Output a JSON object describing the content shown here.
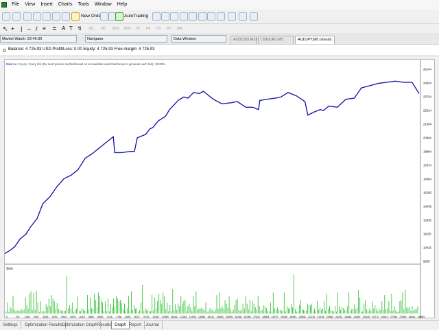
{
  "menu": [
    "File",
    "View",
    "Insert",
    "Charts",
    "Tools",
    "Window",
    "Help"
  ],
  "toolbar": {
    "new_order": "New Order",
    "auto_trading": "AutoTrading",
    "timeframes": [
      "M1",
      "M5",
      "M15",
      "M30",
      "H1",
      "H4",
      "D1",
      "W1",
      "MN"
    ]
  },
  "panels": {
    "market_watch": "Market Watch: 22:40:30",
    "navigator": "Navigator",
    "data_window": "Data Window"
  },
  "chart_tabs": [
    {
      "label": "AUDUSD,M15",
      "active": false
    },
    {
      "label": "USDCAD,M5 (visual)",
      "active": false
    },
    {
      "label": "AUDJPY,M5 (visual)",
      "active": true
    }
  ],
  "balance_line": "Balance: 4 725.93 USD  Profit/Loss: 0.00  Equity: 4 725.93  Free margin: 4 725.93",
  "legend": {
    "balance": "Balance",
    "equity": "Equity",
    "note": "Every tick (the most precise method based on all available least timeframes to generate each tick)",
    "quality": "90.00%"
  },
  "size_label": "Size",
  "colors": {
    "balance": "#1a1aa8",
    "size_bars": "#22bb22"
  },
  "chart_data": {
    "type": "line",
    "y_ticks": [
      "26144",
      "24934",
      "23724",
      "22514",
      "21304",
      "20094",
      "18884",
      "17674",
      "16464",
      "15255",
      "14045",
      "12835",
      "11625",
      "10415",
      "9205"
    ],
    "x_ticks": [
      "0",
      "723",
      "1365",
      "2007",
      "2649",
      "3292",
      "3934",
      "4576",
      "5218",
      "5861",
      "6503",
      "7145",
      "7788",
      "8430",
      "9072",
      "9715",
      "10357",
      "10999",
      "11642",
      "12284",
      "12926",
      "13568",
      "14211",
      "14853",
      "15495",
      "16138",
      "16780",
      "17422",
      "18064",
      "18707",
      "19349",
      "19991",
      "20634",
      "21276",
      "21918",
      "22560",
      "23203",
      "23845",
      "24487",
      "25130",
      "25772",
      "26414",
      "27056",
      "27699",
      "28341",
      "28983"
    ],
    "ylim": [
      9205,
      26144
    ],
    "xlim": [
      0,
      29500
    ],
    "series": [
      {
        "name": "Balance",
        "x": [
          0,
          400,
          700,
          1100,
          1500,
          1800,
          2300,
          2700,
          3200,
          3700,
          4200,
          4700,
          5200,
          5700,
          6200,
          6700,
          7200,
          7700,
          7800,
          8300,
          8900,
          9200,
          9400,
          10000,
          10300,
          10500,
          10900,
          11400,
          11700,
          12300,
          12700,
          13000,
          13400,
          13800,
          14100,
          14800,
          15400,
          16100,
          16500,
          17100,
          17600,
          18000,
          18100,
          18600,
          19200,
          19600,
          20100,
          20700,
          21300,
          21500,
          22000,
          22400,
          22600,
          23000,
          23600,
          24200,
          24800,
          25300,
          25900,
          26500,
          27100,
          27700,
          28300,
          28900,
          29100,
          29400
        ],
        "y": [
          9900,
          10200,
          10500,
          11200,
          11600,
          12200,
          13000,
          14300,
          14900,
          15800,
          16500,
          16800,
          17300,
          18300,
          18700,
          19200,
          19700,
          20200,
          18800,
          18800,
          18900,
          18900,
          20100,
          20400,
          20900,
          21000,
          21600,
          22000,
          22600,
          23400,
          23700,
          23600,
          24100,
          24000,
          24200,
          23500,
          23100,
          23200,
          23300,
          22800,
          22800,
          22600,
          23400,
          23500,
          23600,
          23700,
          24100,
          23800,
          23300,
          22100,
          22400,
          22600,
          22500,
          22900,
          22800,
          23500,
          23600,
          24500,
          24700,
          24900,
          25000,
          25100,
          25000,
          25000,
          24600,
          24000
        ]
      }
    ],
    "size_bars": [
      0.05,
      0.12,
      0.08,
      0.2,
      0.06,
      0.15,
      0.3,
      0.1,
      0.45,
      0.12,
      0.08,
      0.22,
      0.5,
      0.1,
      0.14,
      0.35,
      0.07,
      0.18,
      0.4,
      0.11,
      0.09,
      0.28,
      0.06,
      0.55,
      0.13,
      0.1,
      0.32,
      0.08,
      0.6,
      0.2,
      0.12,
      0.17,
      0.45,
      0.09,
      0.1,
      0.3,
      0.14,
      0.7,
      0.2,
      0.11,
      0.08,
      0.38,
      0.16,
      0.55,
      0.12,
      0.1,
      0.28,
      0.2,
      0.85,
      0.15,
      0.1,
      0.35,
      0.12,
      0.22,
      0.6,
      0.09,
      0.18,
      0.4,
      0.13,
      0.1,
      0.5,
      0.15,
      0.3,
      0.12,
      0.95,
      0.2,
      0.16,
      0.45,
      0.1,
      0.25,
      0.7,
      0.12,
      0.18,
      0.33,
      0.09,
      0.6,
      0.14,
      0.22,
      0.4,
      0.11,
      0.8,
      0.2,
      0.15,
      0.5,
      0.13,
      0.27,
      0.1,
      0.75,
      0.18,
      0.3,
      0.12,
      0.55,
      0.16,
      0.9,
      0.2,
      0.12,
      0.42,
      0.15,
      0.3,
      0.1,
      0.65,
      0.2,
      0.14,
      0.85,
      0.18,
      0.35,
      0.12,
      0.5,
      0.22,
      0.15,
      0.7,
      0.1,
      0.4,
      0.2,
      0.95,
      0.16,
      0.3,
      0.12,
      0.6,
      0.18,
      0.25,
      0.8,
      0.14,
      0.45,
      0.2,
      0.12,
      0.9,
      0.3,
      0.16,
      0.55,
      0.1,
      0.35,
      0.22,
      0.7,
      0.15,
      0.95,
      0.2,
      0.4,
      0.12,
      0.6,
      0.18,
      0.3,
      0.85,
      0.14,
      0.5,
      0.25,
      0.9,
      0.16,
      0.4,
      0.12,
      0.7,
      0.2,
      0.3,
      0.95,
      0.15,
      0.55,
      0.22,
      0.8,
      0.18,
      0.35,
      0.12,
      0.65,
      0.2,
      0.45
    ]
  },
  "bottom_tabs": [
    {
      "label": "Settings",
      "active": false
    },
    {
      "label": "Optimization Results",
      "active": false
    },
    {
      "label": "Optimization Graph",
      "active": false
    },
    {
      "label": "Results",
      "active": false
    },
    {
      "label": "Graph",
      "active": true
    },
    {
      "label": "Report",
      "active": false
    },
    {
      "label": "Journal",
      "active": false
    }
  ]
}
